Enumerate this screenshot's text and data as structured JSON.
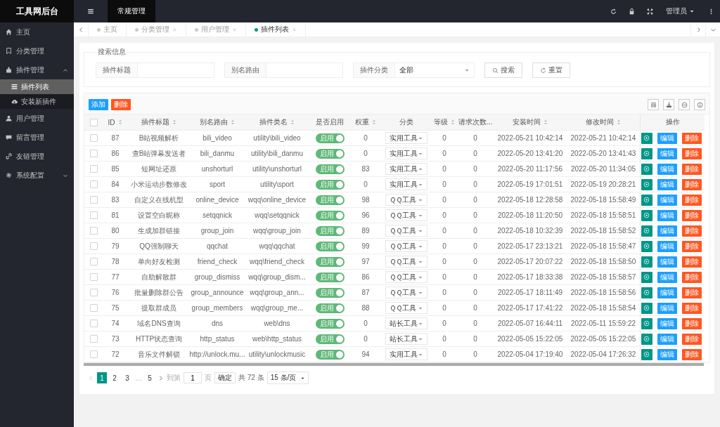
{
  "sidebar": {
    "logo": "工具网后台",
    "items": [
      {
        "label": "主页"
      },
      {
        "label": "分类管理"
      },
      {
        "label": "插件管理",
        "expanded": true,
        "children": [
          {
            "label": "插件列表",
            "selected": true
          },
          {
            "label": "安装新插件",
            "selected": false
          }
        ]
      },
      {
        "label": "用户管理"
      },
      {
        "label": "留言管理"
      },
      {
        "label": "友链管理"
      },
      {
        "label": "系统配置",
        "expanded": false
      }
    ]
  },
  "header": {
    "nav": [
      {
        "label": "常规管理",
        "selected": true
      }
    ],
    "user": "管理员"
  },
  "tabs": [
    {
      "label": "主页",
      "closable": false,
      "selected": false
    },
    {
      "label": "分类管理",
      "closable": true,
      "selected": false
    },
    {
      "label": "用户管理",
      "closable": true,
      "selected": false
    },
    {
      "label": "插件列表",
      "closable": true,
      "selected": true
    }
  ],
  "search": {
    "legend": "搜索信息",
    "fields": [
      {
        "label": "插件标题",
        "kind": "input"
      },
      {
        "label": "别名路由",
        "kind": "input"
      },
      {
        "label": "插件分类",
        "kind": "select",
        "value": "全部"
      }
    ],
    "buttons": [
      "搜索",
      "重置"
    ]
  },
  "toolbar": {
    "buttons": [
      "添加",
      "删除"
    ]
  },
  "table": {
    "select_all_checked": false,
    "columns": [
      {
        "label": "ID",
        "sortable": true
      },
      {
        "label": "插件标题",
        "sortable": true
      },
      {
        "label": "别名路由",
        "sortable": true
      },
      {
        "label": "插件类名",
        "sortable": true
      },
      {
        "label": "是否启用",
        "sortable": false
      },
      {
        "label": "权重",
        "sortable": true
      },
      {
        "label": "分类",
        "sortable": false
      },
      {
        "label": "等级",
        "sortable": true
      },
      {
        "label": "请求次数...",
        "sortable": false
      },
      {
        "label": "安装时间",
        "sortable": true
      },
      {
        "label": "修改时间",
        "sortable": true
      },
      {
        "label": "操作",
        "sortable": false
      }
    ],
    "rows": [
      {
        "checked": false,
        "id": "87",
        "title": "B站视频解析",
        "alias": "bili_video",
        "class_name": "utility\\bili_video",
        "enabled": true,
        "switch_text": "启用",
        "weight": "0",
        "category": "实用工具",
        "level": "0",
        "requests": "0",
        "installed": "2022-05-21 10:42:14",
        "modified": "2022-05-21 10:42:14",
        "actions": [
          "编辑",
          "删除"
        ]
      },
      {
        "checked": false,
        "id": "86",
        "title": "查B站弹幕发送者",
        "alias": "bili_danmu",
        "class_name": "utility\\bili_danmu",
        "enabled": true,
        "switch_text": "启用",
        "weight": "0",
        "category": "实用工具",
        "level": "0",
        "requests": "0",
        "installed": "2022-05-20 13:41:20",
        "modified": "2022-05-20 13:41:43",
        "actions": [
          "编辑",
          "删除"
        ]
      },
      {
        "checked": false,
        "id": "85",
        "title": "短网址还原",
        "alias": "unshorturl",
        "class_name": "utility\\unshorturl",
        "enabled": true,
        "switch_text": "启用",
        "weight": "83",
        "category": "实用工具",
        "level": "0",
        "requests": "0",
        "installed": "2022-05-20 11:17:56",
        "modified": "2022-05-20 11:34:05",
        "actions": [
          "编辑",
          "删除"
        ]
      },
      {
        "checked": false,
        "id": "84",
        "title": "小米运动步数修改",
        "alias": "sport",
        "class_name": "utility\\sport",
        "enabled": true,
        "switch_text": "启用",
        "weight": "0",
        "category": "实用工具",
        "level": "0",
        "requests": "0",
        "installed": "2022-05-19 17:01:51",
        "modified": "2022-05-19 20:28:21",
        "actions": [
          "编辑",
          "删除"
        ]
      },
      {
        "checked": false,
        "id": "83",
        "title": "自定义在线机型",
        "alias": "online_device",
        "class_name": "wqq\\online_device",
        "enabled": true,
        "switch_text": "启用",
        "weight": "98",
        "category": "ＱＱ工具",
        "level": "0",
        "requests": "0",
        "installed": "2022-05-18 12:28:58",
        "modified": "2022-05-18 15:58:49",
        "actions": [
          "编辑",
          "删除"
        ]
      },
      {
        "checked": false,
        "id": "81",
        "title": "设置空白昵称",
        "alias": "setqqnick",
        "class_name": "wqq\\setqqnick",
        "enabled": true,
        "switch_text": "启用",
        "weight": "96",
        "category": "ＱＱ工具",
        "level": "0",
        "requests": "0",
        "installed": "2022-05-18 11:20:50",
        "modified": "2022-05-18 15:58:51",
        "actions": [
          "编辑",
          "删除"
        ]
      },
      {
        "checked": false,
        "id": "80",
        "title": "生成加群链接",
        "alias": "group_join",
        "class_name": "wqq\\group_join",
        "enabled": true,
        "switch_text": "启用",
        "weight": "89",
        "category": "ＱＱ工具",
        "level": "0",
        "requests": "0",
        "installed": "2022-05-18 10:32:39",
        "modified": "2022-05-18 15:58:52",
        "actions": [
          "编辑",
          "删除"
        ]
      },
      {
        "checked": false,
        "id": "79",
        "title": "QQ强制聊天",
        "alias": "qqchat",
        "class_name": "wqq\\qqchat",
        "enabled": true,
        "switch_text": "启用",
        "weight": "99",
        "category": "ＱＱ工具",
        "level": "0",
        "requests": "0",
        "installed": "2022-05-17 23:13:21",
        "modified": "2022-05-18 15:58:47",
        "actions": [
          "编辑",
          "删除"
        ]
      },
      {
        "checked": false,
        "id": "78",
        "title": "单向好友检测",
        "alias": "friend_check",
        "class_name": "wqq\\friend_check",
        "enabled": true,
        "switch_text": "启用",
        "weight": "97",
        "category": "ＱＱ工具",
        "level": "0",
        "requests": "0",
        "installed": "2022-05-17 20:07:22",
        "modified": "2022-05-18 15:58:50",
        "actions": [
          "编辑",
          "删除"
        ]
      },
      {
        "checked": false,
        "id": "77",
        "title": "自助解散群",
        "alias": "group_dismiss",
        "class_name": "wqq\\group_dism...",
        "enabled": true,
        "switch_text": "启用",
        "weight": "86",
        "category": "ＱＱ工具",
        "level": "0",
        "requests": "0",
        "installed": "2022-05-17 18:33:38",
        "modified": "2022-05-18 15:58:57",
        "actions": [
          "编辑",
          "删除"
        ]
      },
      {
        "checked": false,
        "id": "76",
        "title": "批量删除群公告",
        "alias": "group_announce",
        "class_name": "wqq\\group_ann...",
        "enabled": true,
        "switch_text": "启用",
        "weight": "87",
        "category": "ＱＱ工具",
        "level": "0",
        "requests": "0",
        "installed": "2022-05-17 18:11:49",
        "modified": "2022-05-18 15:58:56",
        "actions": [
          "编辑",
          "删除"
        ]
      },
      {
        "checked": false,
        "id": "75",
        "title": "提取群成员",
        "alias": "group_members",
        "class_name": "wqq\\group_me...",
        "enabled": true,
        "switch_text": "启用",
        "weight": "88",
        "category": "ＱＱ工具",
        "level": "0",
        "requests": "0",
        "installed": "2022-05-17 17:41:22",
        "modified": "2022-05-18 15:58:54",
        "actions": [
          "编辑",
          "删除"
        ]
      },
      {
        "checked": false,
        "id": "74",
        "title": "域名DNS查询",
        "alias": "dns",
        "class_name": "web\\dns",
        "enabled": true,
        "switch_text": "启用",
        "weight": "0",
        "category": "站长工具",
        "level": "0",
        "requests": "0",
        "installed": "2022-05-07 16:44:11",
        "modified": "2022-05-11 15:59:22",
        "actions": [
          "编辑",
          "删除"
        ]
      },
      {
        "checked": false,
        "id": "73",
        "title": "HTTP状态查询",
        "alias": "http_status",
        "class_name": "web\\http_status",
        "enabled": true,
        "switch_text": "启用",
        "weight": "0",
        "category": "站长工具",
        "level": "0",
        "requests": "0",
        "installed": "2022-05-05 15:22:05",
        "modified": "2022-05-05 15:22:05",
        "actions": [
          "编辑",
          "删除"
        ]
      },
      {
        "checked": false,
        "id": "72",
        "title": "音乐文件解锁",
        "alias": "http://unlock.mu...",
        "class_name": "utility\\unlockmusic",
        "enabled": true,
        "switch_text": "启用",
        "weight": "94",
        "category": "实用工具",
        "level": "0",
        "requests": "0",
        "installed": "2022-05-04 17:19:40",
        "modified": "2022-05-04 17:26:32",
        "actions": [
          "编辑",
          "删除"
        ]
      }
    ]
  },
  "pagination": {
    "pages": [
      {
        "kind": "page",
        "label": "1",
        "selected": true
      },
      {
        "kind": "page",
        "label": "2",
        "selected": false
      },
      {
        "kind": "page",
        "label": "3",
        "selected": false
      },
      {
        "kind": "ellipsis",
        "label": "…"
      },
      {
        "kind": "page",
        "label": "5",
        "selected": false
      }
    ],
    "goto_prefix": "到第",
    "goto_value": "1",
    "goto_suffix": "页",
    "confirm": "确定",
    "total": "共 72 条",
    "page_size": "15 条/页"
  }
}
